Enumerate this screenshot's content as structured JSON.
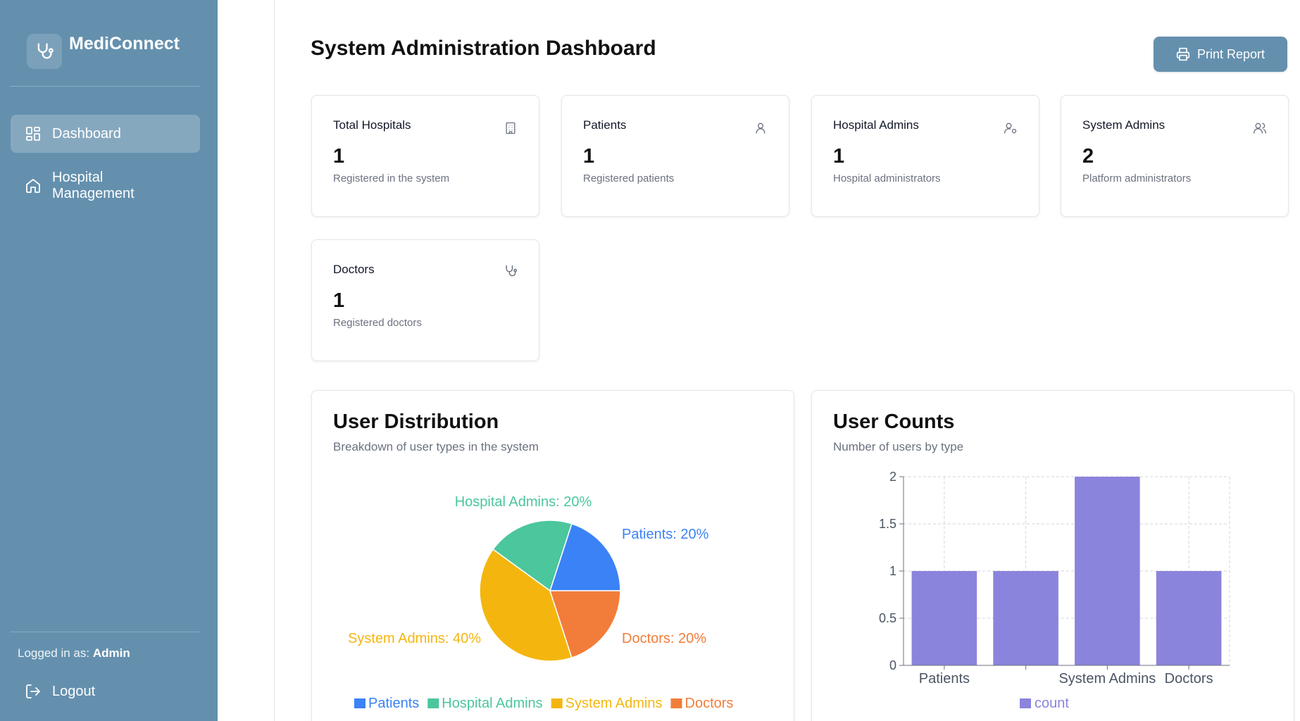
{
  "sidebar": {
    "app_name": "MediConnect",
    "items": [
      {
        "label": "Dashboard",
        "icon": "dashboard-grid-icon",
        "active": true
      },
      {
        "label": "Hospital Management",
        "icon": "home-icon",
        "active": false
      }
    ],
    "logged_in_prefix": "Logged in as:",
    "logged_in_user": "Admin",
    "logout_label": "Logout"
  },
  "header": {
    "title": "System Administration Dashboard",
    "print_label": "Print Report"
  },
  "stats": [
    {
      "title": "Total Hospitals",
      "value": "1",
      "desc": "Registered in the system",
      "icon": "building-icon"
    },
    {
      "title": "Patients",
      "value": "1",
      "desc": "Registered patients",
      "icon": "user-icon"
    },
    {
      "title": "Hospital Admins",
      "value": "1",
      "desc": "Hospital administrators",
      "icon": "user-cog-icon"
    },
    {
      "title": "System Admins",
      "value": "2",
      "desc": "Platform administrators",
      "icon": "users-icon"
    },
    {
      "title": "Doctors",
      "value": "1",
      "desc": "Registered doctors",
      "icon": "stethoscope-icon"
    }
  ],
  "distribution": {
    "title": "User Distribution",
    "subtitle": "Breakdown of user types in the system"
  },
  "counts": {
    "title": "User Counts",
    "subtitle": "Number of users by type"
  },
  "colors": {
    "sidebar": "#6490ae",
    "patients": "#3b82f6",
    "hospital_admins": "#4bc69d",
    "system_admins": "#f4b60e",
    "doctors": "#f27d3a",
    "bar": "#8b84dc"
  },
  "chart_data": [
    {
      "type": "pie",
      "categories": [
        "Patients",
        "Hospital Admins",
        "System Admins",
        "Doctors"
      ],
      "values": [
        1,
        1,
        2,
        1
      ],
      "slice_labels": [
        "Patients: 20%",
        "Hospital Admins: 20%",
        "System Admins: 40%",
        "Doctors: 20%"
      ],
      "colors": [
        "#3b82f6",
        "#4bc69d",
        "#f4b60e",
        "#f27d3a"
      ],
      "legend": "bottom"
    },
    {
      "type": "bar",
      "categories": [
        "Patients",
        "Hospital Admins",
        "System Admins",
        "Doctors"
      ],
      "visible_tick_labels": [
        "Patients",
        "",
        "System Admins",
        "Doctors"
      ],
      "series": [
        {
          "name": "count",
          "values": [
            1,
            1,
            2,
            1
          ]
        }
      ],
      "ylim": [
        0,
        2
      ],
      "yticks": [
        "0",
        "0.5",
        "1",
        "1.5",
        "2"
      ],
      "grid": true,
      "legend": "bottom",
      "color": "#8b84dc"
    }
  ]
}
